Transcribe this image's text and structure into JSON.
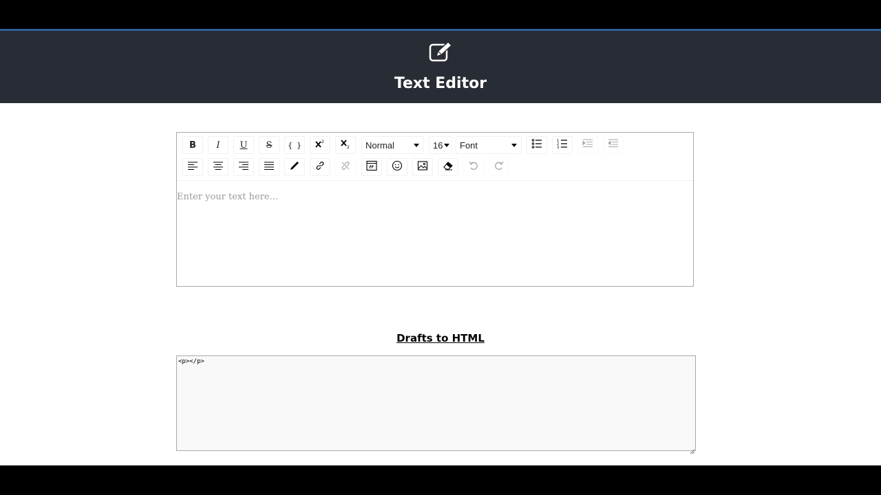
{
  "header": {
    "icon": "edit-icon",
    "title": "Text Editor"
  },
  "toolbar": {
    "row1": {
      "bold_label": "B",
      "italic_label": "I",
      "underline_label": "U",
      "strikethrough_label": "S",
      "code_label": "{ }",
      "block_type": "Normal",
      "font_size": "16",
      "font_family": "Font"
    },
    "icons": [
      "bold-icon",
      "italic-icon",
      "underline-icon",
      "strikethrough-icon",
      "code-icon",
      "superscript-icon",
      "subscript-icon",
      "unordered-list-icon",
      "ordered-list-icon",
      "indent-icon",
      "outdent-icon",
      "align-left-icon",
      "align-center-icon",
      "align-right-icon",
      "align-justify-icon",
      "color-picker-icon",
      "link-icon",
      "unlink-icon",
      "embedded-icon",
      "emoji-icon",
      "image-icon",
      "eraser-icon",
      "undo-icon",
      "redo-icon"
    ]
  },
  "editor": {
    "placeholder": "Enter your text here..."
  },
  "output": {
    "title": "Drafts to HTML",
    "value": "<p></p>"
  }
}
